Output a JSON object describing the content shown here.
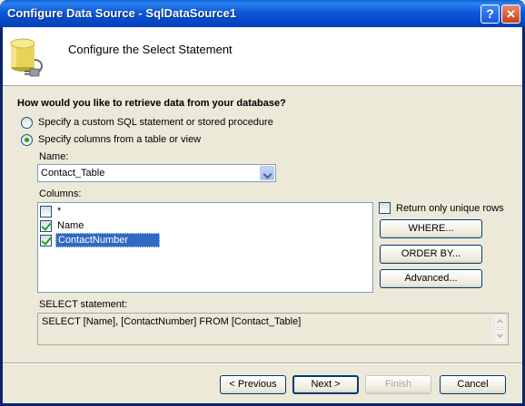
{
  "window": {
    "title": "Configure Data Source - SqlDataSource1",
    "help_glyph": "?",
    "close_glyph": "✕",
    "icon": "database-plug-icon"
  },
  "header": {
    "title": "Configure the Select Statement"
  },
  "question": "How would you like to retrieve data from your database?",
  "options": {
    "custom_sql_label": "Specify a custom SQL statement or stored procedure",
    "columns_label": "Specify columns from a table or view",
    "selected": "columns"
  },
  "name_field": {
    "label": "Name:",
    "value": "Contact_Table"
  },
  "columns_field": {
    "label": "Columns:",
    "items": [
      {
        "label": "*",
        "checked": false,
        "selected": false
      },
      {
        "label": "Name",
        "checked": true,
        "selected": false
      },
      {
        "label": "ContactNumber",
        "checked": true,
        "selected": true
      }
    ]
  },
  "unique_rows": {
    "label": "Return only unique rows",
    "checked": false
  },
  "buttons": {
    "where": "WHERE...",
    "order_by": "ORDER BY...",
    "advanced": "Advanced...",
    "previous": "< Previous",
    "next": "Next >",
    "finish": "Finish",
    "cancel": "Cancel"
  },
  "select_statement": {
    "label": "SELECT statement:",
    "value": "SELECT [Name], [ContactNumber] FROM [Contact_Table]"
  },
  "colors": {
    "titlebar": "#0a5fd6",
    "dialog_bg": "#ece9d8",
    "selection": "#316ac5",
    "check": "#21a121"
  }
}
